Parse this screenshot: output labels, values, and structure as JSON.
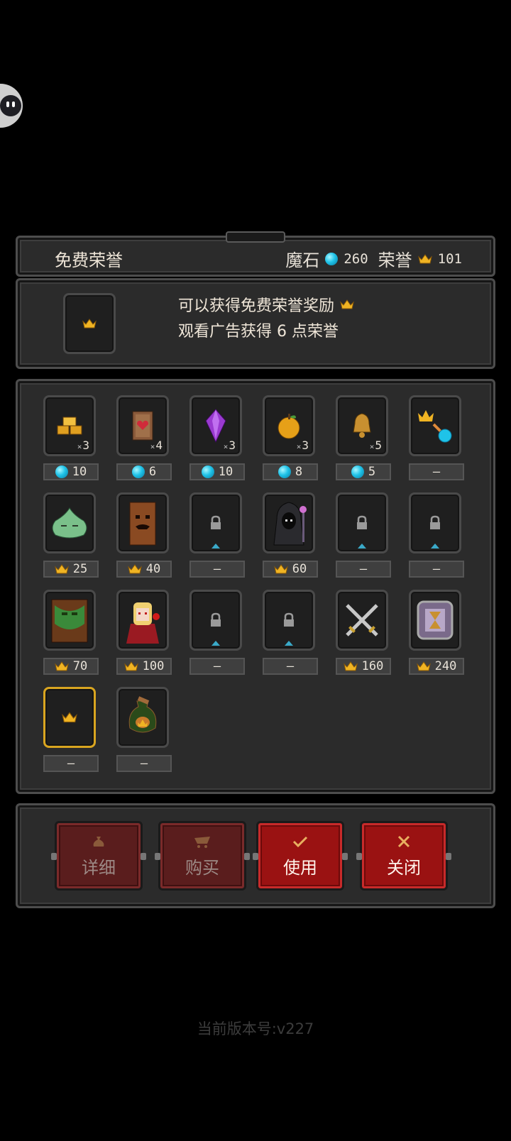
{
  "header": {
    "title": "免费荣誉",
    "magic_stone_label": "魔石",
    "magic_stone_value": "260",
    "honor_label": "荣誉",
    "honor_value": "101"
  },
  "info": {
    "line1": "可以获得免费荣誉奖励",
    "line2": "观看广告获得 6 点荣誉"
  },
  "items": [
    {
      "icon": "gold-bars-icon",
      "qty": "3",
      "price": "10",
      "currency": "gem"
    },
    {
      "icon": "heart-scroll-icon",
      "qty": "4",
      "price": "6",
      "currency": "gem"
    },
    {
      "icon": "purple-crystal-icon",
      "qty": "3",
      "price": "10",
      "currency": "gem"
    },
    {
      "icon": "golden-apple-icon",
      "qty": "3",
      "price": "8",
      "currency": "gem"
    },
    {
      "icon": "bell-icon",
      "qty": "5",
      "price": "5",
      "currency": "gem"
    },
    {
      "icon": "crown-to-gem-icon",
      "qty": "",
      "price": "—",
      "currency": "none"
    },
    {
      "icon": "green-slime-icon",
      "qty": "",
      "price": "25",
      "currency": "crown"
    },
    {
      "icon": "tree-monster-icon",
      "qty": "",
      "price": "40",
      "currency": "crown"
    },
    {
      "icon": "lock-icon",
      "qty": "",
      "price": "—",
      "currency": "none"
    },
    {
      "icon": "hooded-reaper-icon",
      "qty": "",
      "price": "60",
      "currency": "crown"
    },
    {
      "icon": "lock-icon",
      "qty": "",
      "price": "—",
      "currency": "none"
    },
    {
      "icon": "lock-icon",
      "qty": "",
      "price": "—",
      "currency": "none"
    },
    {
      "icon": "forest-guardian-icon",
      "qty": "",
      "price": "70",
      "currency": "crown"
    },
    {
      "icon": "vampire-girl-icon",
      "qty": "",
      "price": "100",
      "currency": "crown"
    },
    {
      "icon": "lock-icon",
      "qty": "",
      "price": "—",
      "currency": "none"
    },
    {
      "icon": "lock-icon",
      "qty": "",
      "price": "—",
      "currency": "none"
    },
    {
      "icon": "crossed-swords-icon",
      "qty": "",
      "price": "160",
      "currency": "crown"
    },
    {
      "icon": "hourglass-frame-icon",
      "qty": "",
      "price": "240",
      "currency": "crown"
    },
    {
      "icon": "crown-icon",
      "qty": "",
      "price": "—",
      "currency": "none"
    },
    {
      "icon": "honor-bag-icon",
      "qty": "",
      "price": "—",
      "currency": "none"
    }
  ],
  "buttons": {
    "detail": "详细",
    "buy": "购买",
    "use": "使用",
    "close": "关闭"
  },
  "version_text": "当前版本号:v227",
  "colors": {
    "gem": "#1fc3e8",
    "crown": "#f0b423",
    "active_button": "#9a1212",
    "selected_border": "#d9a520"
  }
}
